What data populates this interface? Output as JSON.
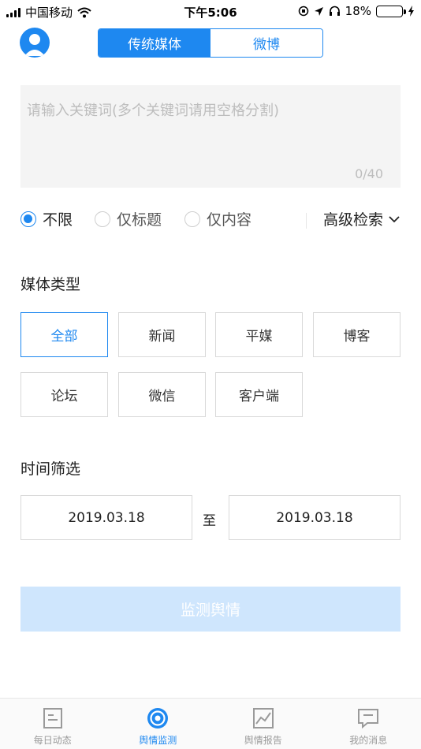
{
  "status_bar": {
    "carrier": "中国移动",
    "time": "下午5:06",
    "battery_percent": "18%",
    "battery_level": 0.18
  },
  "header": {
    "tabs": [
      {
        "label": "传统媒体",
        "active": true
      },
      {
        "label": "微博",
        "active": false
      }
    ]
  },
  "keyword": {
    "value": "",
    "placeholder": "请输入关键词(多个关键词请用空格分割)",
    "counter": "0/40"
  },
  "scope": {
    "options": [
      {
        "label": "不限",
        "checked": true
      },
      {
        "label": "仅标题",
        "checked": false
      },
      {
        "label": "仅内容",
        "checked": false
      }
    ],
    "advanced_label": "高级检索"
  },
  "media_type": {
    "title": "媒体类型",
    "options": [
      {
        "label": "全部",
        "active": true
      },
      {
        "label": "新闻",
        "active": false
      },
      {
        "label": "平媒",
        "active": false
      },
      {
        "label": "博客",
        "active": false
      },
      {
        "label": "论坛",
        "active": false
      },
      {
        "label": "微信",
        "active": false
      },
      {
        "label": "客户端",
        "active": false
      }
    ]
  },
  "time_filter": {
    "title": "时间筛选",
    "start": "2019.03.18",
    "separator": "至",
    "end": "2019.03.18"
  },
  "submit_label": "监测舆情",
  "bottom_nav": [
    {
      "label": "每日动态",
      "icon": "document-icon",
      "active": false
    },
    {
      "label": "舆情监测",
      "icon": "radar-icon",
      "active": true
    },
    {
      "label": "舆情报告",
      "icon": "chart-icon",
      "active": false
    },
    {
      "label": "我的消息",
      "icon": "message-icon",
      "active": false
    }
  ],
  "colors": {
    "accent": "#1e88f0",
    "submit_disabled": "#cfe6fd",
    "battery_low": "#e02020"
  }
}
